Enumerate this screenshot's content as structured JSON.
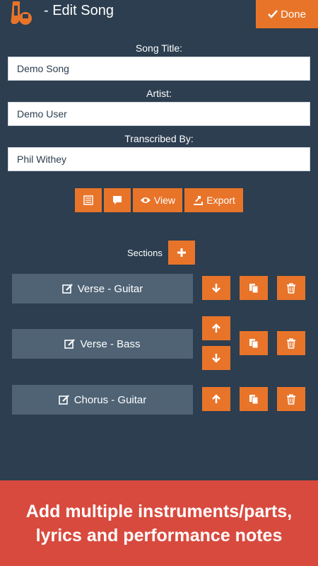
{
  "header": {
    "title": "-  Edit Song",
    "done_label": "Done"
  },
  "form": {
    "song_title_label": "Song Title:",
    "song_title_value": "Demo Song",
    "artist_label": "Artist:",
    "artist_value": "Demo User",
    "transcribed_label": "Transcribed By:",
    "transcribed_value": "Phil Withey"
  },
  "toolbar": {
    "view_label": "View",
    "export_label": "Export"
  },
  "sections": {
    "label": "Sections",
    "items": [
      {
        "name": "Verse - Guitar"
      },
      {
        "name": "Verse - Bass"
      },
      {
        "name": "Chorus - Guitar"
      }
    ]
  },
  "banner": {
    "line1": "Add multiple instruments/parts,",
    "line2": "lyrics and performance notes"
  },
  "colors": {
    "background": "#2c3e50",
    "accent": "#e8742a",
    "section": "#4f6375",
    "banner": "#d84a3e"
  }
}
